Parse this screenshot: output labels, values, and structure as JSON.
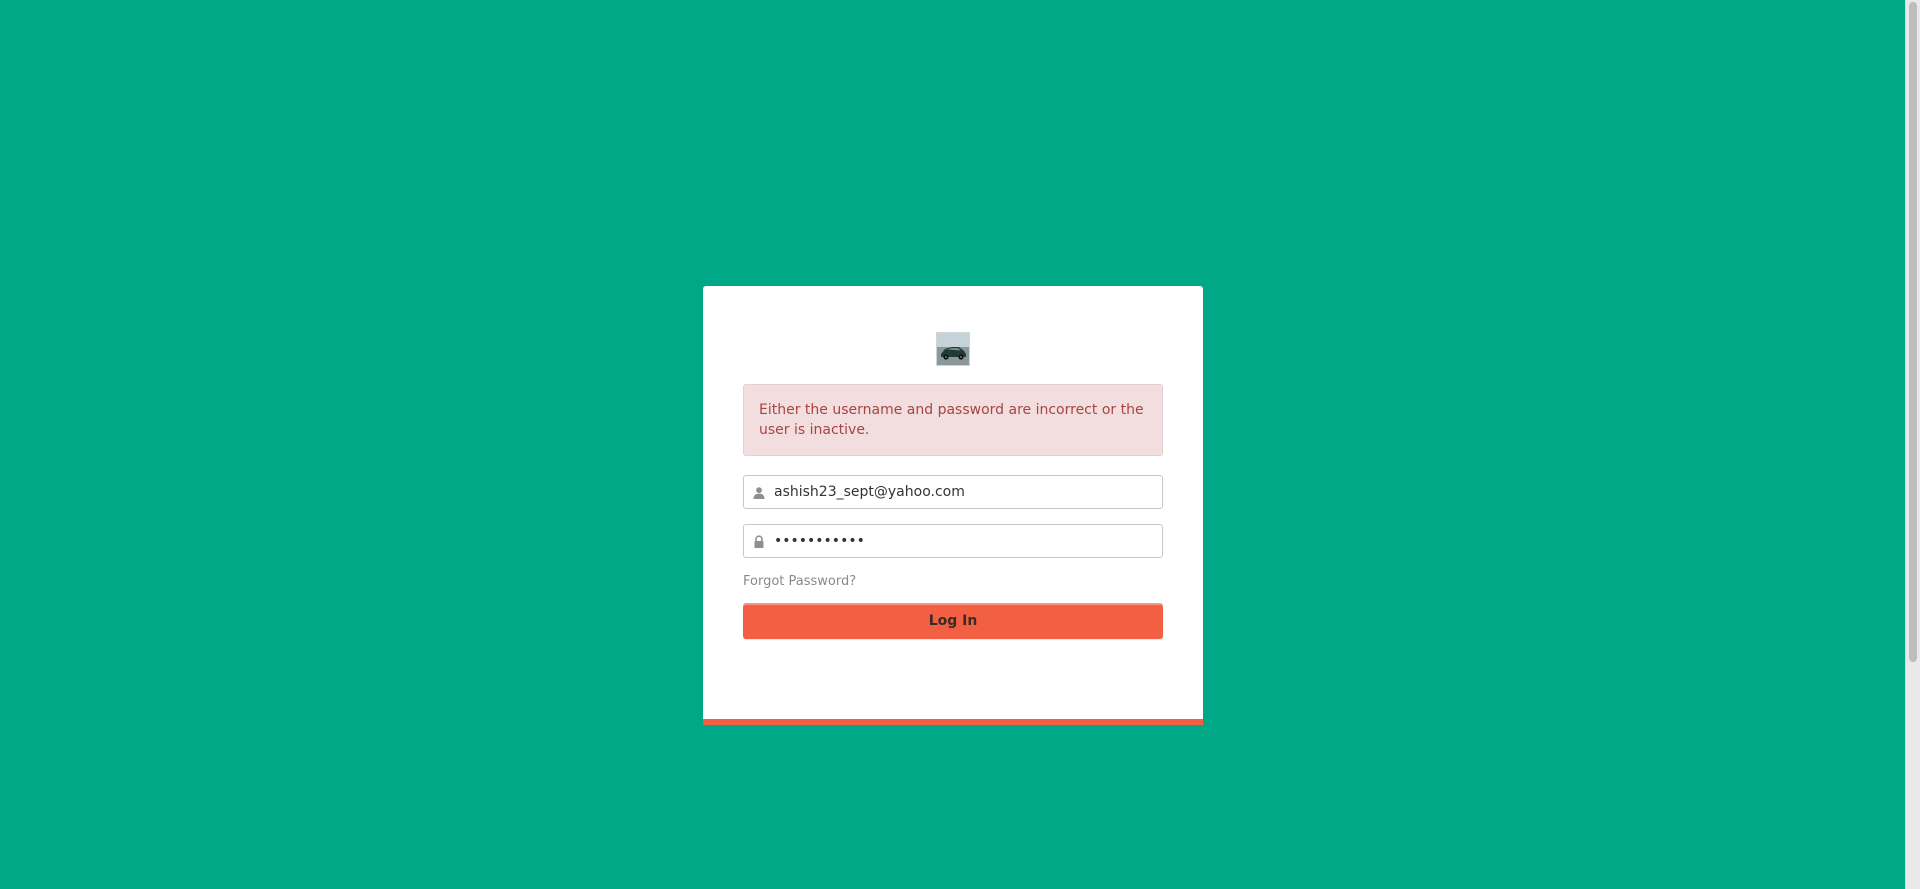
{
  "colors": {
    "page_background": "#00a888",
    "accent": "#f25f43",
    "alert_text": "#a94442",
    "alert_background": "#f2dede"
  },
  "logo": {
    "icon": "car-logo-icon"
  },
  "alert": {
    "message": "Either the username and password are incorrect or the user is inactive."
  },
  "username": {
    "icon": "user-icon",
    "value": "ashish23_sept@yahoo.com"
  },
  "password": {
    "icon": "lock-icon",
    "value": "•••••••••••"
  },
  "forgot_password": {
    "label": "Forgot Password?"
  },
  "login_button": {
    "label": "Log In"
  }
}
